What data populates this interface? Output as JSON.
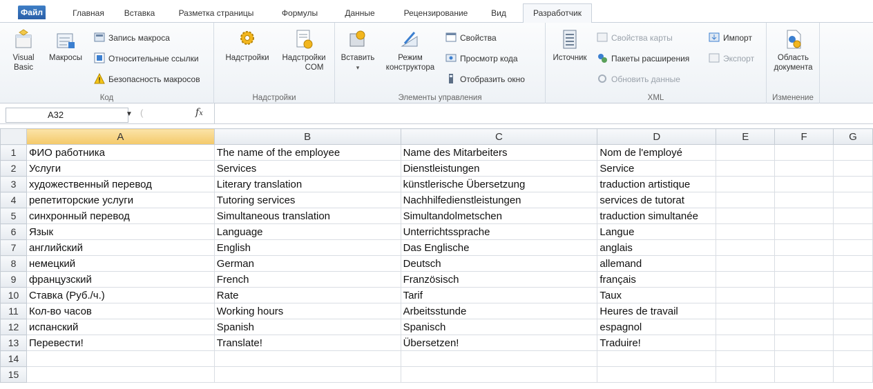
{
  "tabs": [
    "Файл",
    "Главная",
    "Вставка",
    "Разметка страницы",
    "Формулы",
    "Данные",
    "Рецензирование",
    "Вид",
    "Разработчик"
  ],
  "ribbon": {
    "code": {
      "label": "Код",
      "visual_basic_1": "Visual",
      "visual_basic_2": "Basic",
      "macros": "Макросы",
      "record_macro": "Запись макроса",
      "relative_refs": "Относительные ссылки",
      "macro_security": "Безопасность макросов"
    },
    "addins": {
      "label": "Надстройки",
      "addins": "Надстройки",
      "com_addins_1": "Надстройки",
      "com_addins_2": "COM"
    },
    "controls": {
      "label": "Элементы управления",
      "insert": "Вставить",
      "design_mode_1": "Режим",
      "design_mode_2": "конструктора",
      "properties": "Свойства",
      "view_code": "Просмотр кода",
      "run_dialog": "Отобразить окно"
    },
    "xml": {
      "label": "XML",
      "source": "Источник",
      "map_properties": "Свойства карты",
      "expansion_packs": "Пакеты расширения",
      "refresh_data": "Обновить данные",
      "import": "Импорт",
      "export": "Экспорт"
    },
    "modify": {
      "label": "Изменение",
      "doc_panel_1": "Область",
      "doc_panel_2": "документа"
    }
  },
  "formula_bar": {
    "name_box": "A32",
    "fx": "fx",
    "value": ""
  },
  "columns": [
    "A",
    "B",
    "C",
    "D",
    "E",
    "F",
    "G"
  ],
  "rows": [
    [
      "ФИО работника",
      "The name of the employee",
      "Name des Mitarbeiters",
      "Nom de l'employé"
    ],
    [
      "Услуги",
      "Services",
      "Dienstleistungen",
      "Service"
    ],
    [
      "художественный перевод",
      "Literary translation",
      "künstlerische Übersetzung",
      "traduction artistique"
    ],
    [
      "репетиторские услуги",
      "Tutoring services",
      "Nachhilfedienstleistungen",
      "services de tutorat"
    ],
    [
      "синхронный перевод",
      "Simultaneous translation",
      "Simultandolmetschen",
      "traduction simultanée"
    ],
    [
      "Язык",
      "Language",
      "Unterrichtssprache",
      "Langue"
    ],
    [
      "английский",
      "English",
      "Das Englische",
      "anglais"
    ],
    [
      "немецкий",
      "German",
      "Deutsch",
      "allemand"
    ],
    [
      "французский",
      "French",
      "Französisch",
      "français"
    ],
    [
      "Ставка (Руб./ч.)",
      "Rate",
      "Tarif",
      "Taux"
    ],
    [
      "Кол-во часов",
      "Working hours",
      "Arbeitsstunde",
      "Heures de travail"
    ],
    [
      "испанский",
      "Spanish",
      "Spanisch",
      "espagnol"
    ],
    [
      "Перевести!",
      "Translate!",
      "Übersetzen!",
      "Traduire!"
    ],
    [
      "",
      "",
      "",
      ""
    ],
    [
      "",
      "",
      "",
      ""
    ]
  ],
  "row_numbers": [
    "1",
    "2",
    "3",
    "4",
    "5",
    "6",
    "7",
    "8",
    "9",
    "10",
    "11",
    "12",
    "13",
    "14",
    "15"
  ]
}
